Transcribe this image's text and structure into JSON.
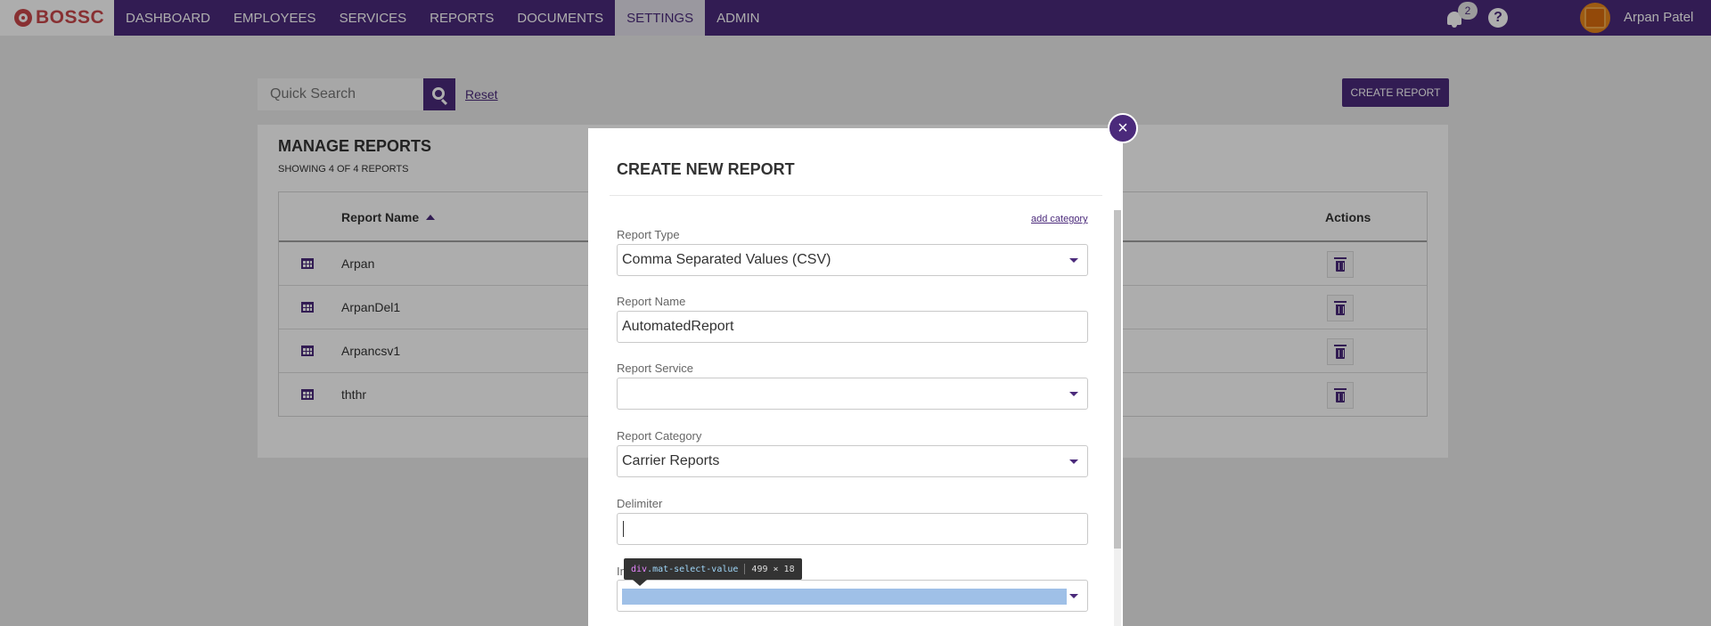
{
  "app": {
    "logo_text": "BOSSC"
  },
  "nav": {
    "items": [
      {
        "label": "DASHBOARD"
      },
      {
        "label": "EMPLOYEES"
      },
      {
        "label": "SERVICES"
      },
      {
        "label": "REPORTS"
      },
      {
        "label": "DOCUMENTS"
      },
      {
        "label": "SETTINGS",
        "active": true
      },
      {
        "label": "ADMIN"
      }
    ]
  },
  "header": {
    "notification_count": "2",
    "help_label": "?",
    "user_name": "Arpan Patel"
  },
  "search": {
    "placeholder": "Quick Search",
    "reset_label": "Reset"
  },
  "toolbar": {
    "create_report_label": "CREATE REPORT"
  },
  "manage": {
    "title": "MANAGE REPORTS",
    "subtitle": "SHOWING 4 OF 4 REPORTS",
    "columns": {
      "name": "Report Name",
      "actions": "Actions"
    },
    "rows": [
      {
        "name": "Arpan"
      },
      {
        "name": "ArpanDel1"
      },
      {
        "name": "Arpancsv1"
      },
      {
        "name": "ththr"
      }
    ]
  },
  "modal": {
    "title": "CREATE NEW REPORT",
    "add_category_label": "add category",
    "close_label": "×",
    "fields": {
      "report_type": {
        "label": "Report Type",
        "value": "Comma Separated Values (CSV)"
      },
      "report_name": {
        "label": "Report Name",
        "value": "AutomatedReport"
      },
      "report_service": {
        "label": "Report Service",
        "value": ""
      },
      "report_category": {
        "label": "Report Category",
        "value": "Carrier Reports"
      },
      "delimiter": {
        "label": "Delimiter",
        "value": ""
      },
      "partial_label": "In"
    }
  },
  "devtools_tooltip": {
    "tag": "div",
    "class": ".mat-select-value",
    "size": "499 × 18"
  },
  "colors": {
    "brand": "#4b2a7b",
    "logo": "#c9484b",
    "avatar": "#e8861b"
  },
  "icons": [
    "logo-icon",
    "bell-icon",
    "help-icon",
    "avatar",
    "search-icon",
    "grid-icon",
    "trash-icon",
    "close-icon",
    "chevron-down-icon"
  ]
}
